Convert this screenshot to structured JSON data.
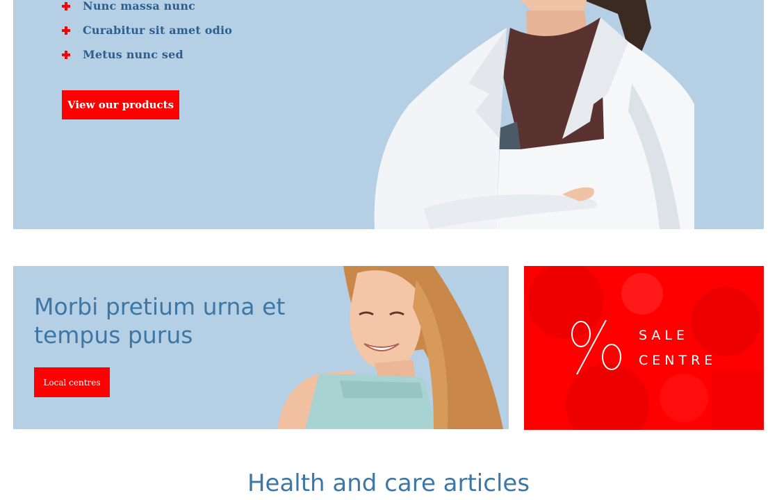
{
  "hero": {
    "features": [
      "Nunc massa nunc",
      "Curabitur sit amet odio",
      "Metus nunc sed"
    ],
    "button_label": "View our products"
  },
  "promo": {
    "title": "Morbi pretium urna et tempus purus",
    "button_label": "Local centres"
  },
  "sale": {
    "percent_symbol": "%",
    "line1": "SALE",
    "line2": "CENTRE"
  },
  "articles": {
    "title": "Health and care articles"
  },
  "colors": {
    "accent_red": "#ff0000",
    "banner_blue": "#b5cfe4",
    "heading_blue": "#3d77a6",
    "text_navy": "#2c5f8f"
  }
}
